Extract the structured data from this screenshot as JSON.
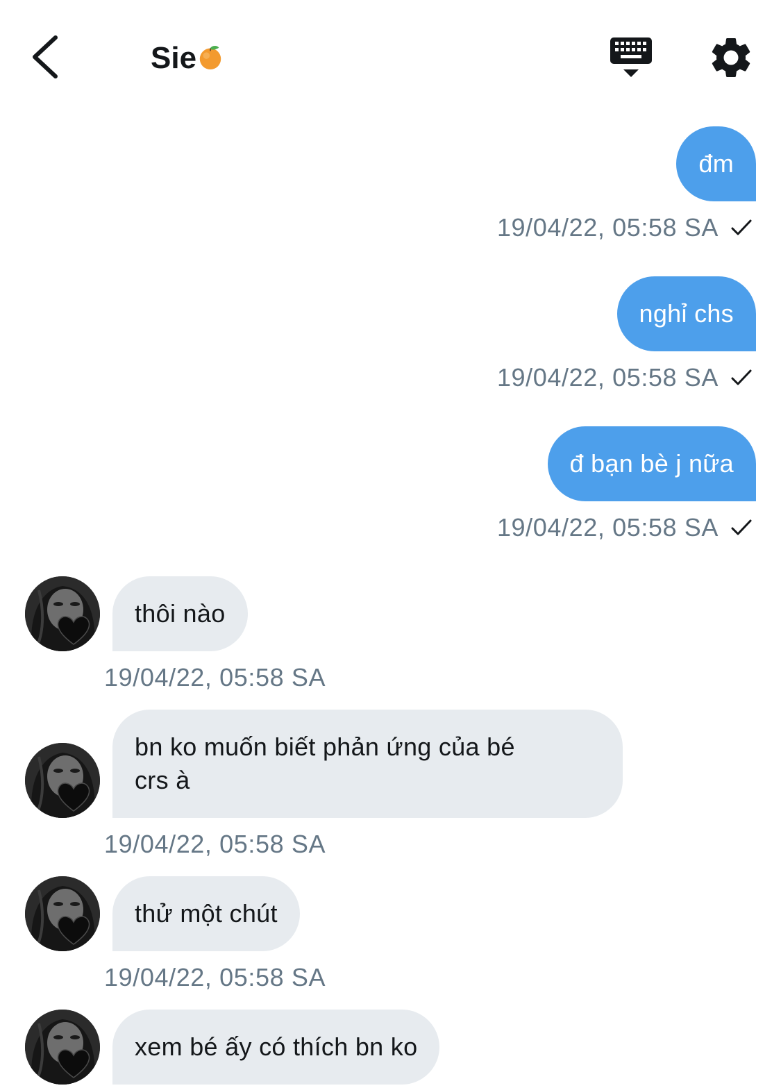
{
  "header": {
    "title": "Sie",
    "title_emoji": "tangerine-emoji",
    "back_icon": "chevron-left-icon",
    "keyboard_icon": "keyboard-icon",
    "settings_icon": "gear-icon"
  },
  "colors": {
    "outgoing_bubble": "#4d9feb",
    "incoming_bubble": "#e7ebef",
    "timestamp": "#657786",
    "text_dark": "#14171a"
  },
  "messages": [
    {
      "direction": "out",
      "text": "đm",
      "time": "19/04/22, 05:58 SA",
      "status_icon": "checkmark-icon"
    },
    {
      "direction": "out",
      "text": "nghỉ chs",
      "time": "19/04/22, 05:58 SA",
      "status_icon": "checkmark-icon"
    },
    {
      "direction": "out",
      "text": "đ bạn bè j nữa",
      "time": "19/04/22, 05:58 SA",
      "status_icon": "checkmark-icon"
    },
    {
      "direction": "in",
      "text": "thôi nào",
      "time": "19/04/22, 05:58 SA"
    },
    {
      "direction": "in",
      "text_line1": "bn ko muốn biết phản ứng của bé",
      "text_line2": "crs à",
      "time": "19/04/22, 05:58 SA"
    },
    {
      "direction": "in",
      "text": "thử một chút",
      "time": "19/04/22, 05:58 SA"
    },
    {
      "direction": "in",
      "text": "xem bé ấy có thích bn ko"
    }
  ]
}
